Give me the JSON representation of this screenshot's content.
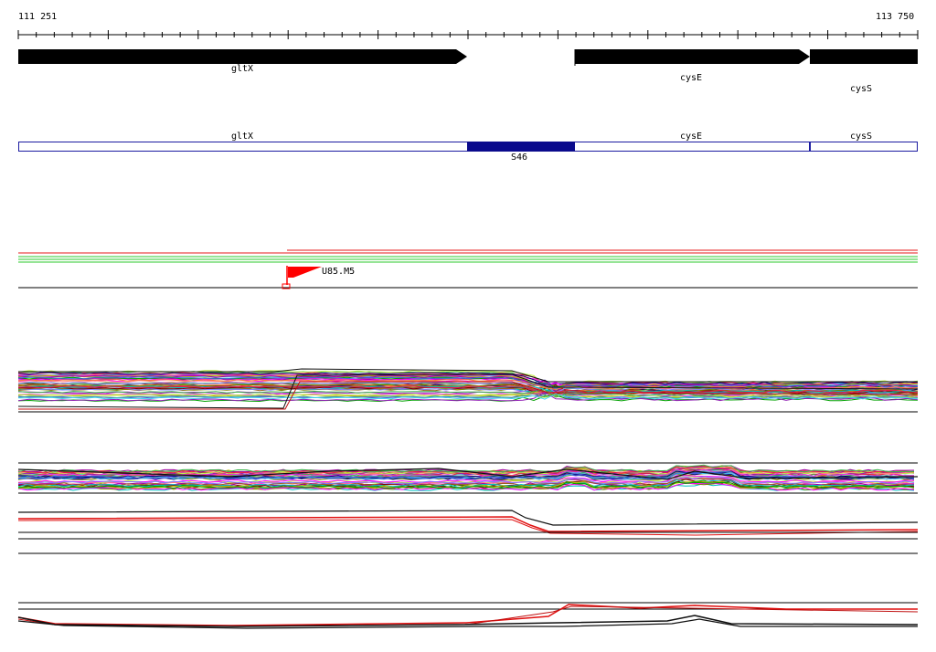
{
  "ruler": {
    "start_label": "111 251",
    "end_label": "113 750"
  },
  "genes": [
    {
      "name": "gltX",
      "strand": "+"
    },
    {
      "name": "cysE",
      "strand": "+"
    },
    {
      "name": "cysS",
      "strand": "+"
    }
  ],
  "regions": [
    {
      "name": "gltX"
    },
    {
      "name": "S46",
      "highlight": true
    },
    {
      "name": "cysE"
    },
    {
      "name": "cysS"
    }
  ],
  "marker": {
    "label": "U85.M5",
    "color": "#ff0000"
  },
  "colors": {
    "gene_arrow": "#000000",
    "region_border": "#1a1aa0",
    "region_highlight": "#0a0a8c",
    "flag": "#ff0000"
  }
}
